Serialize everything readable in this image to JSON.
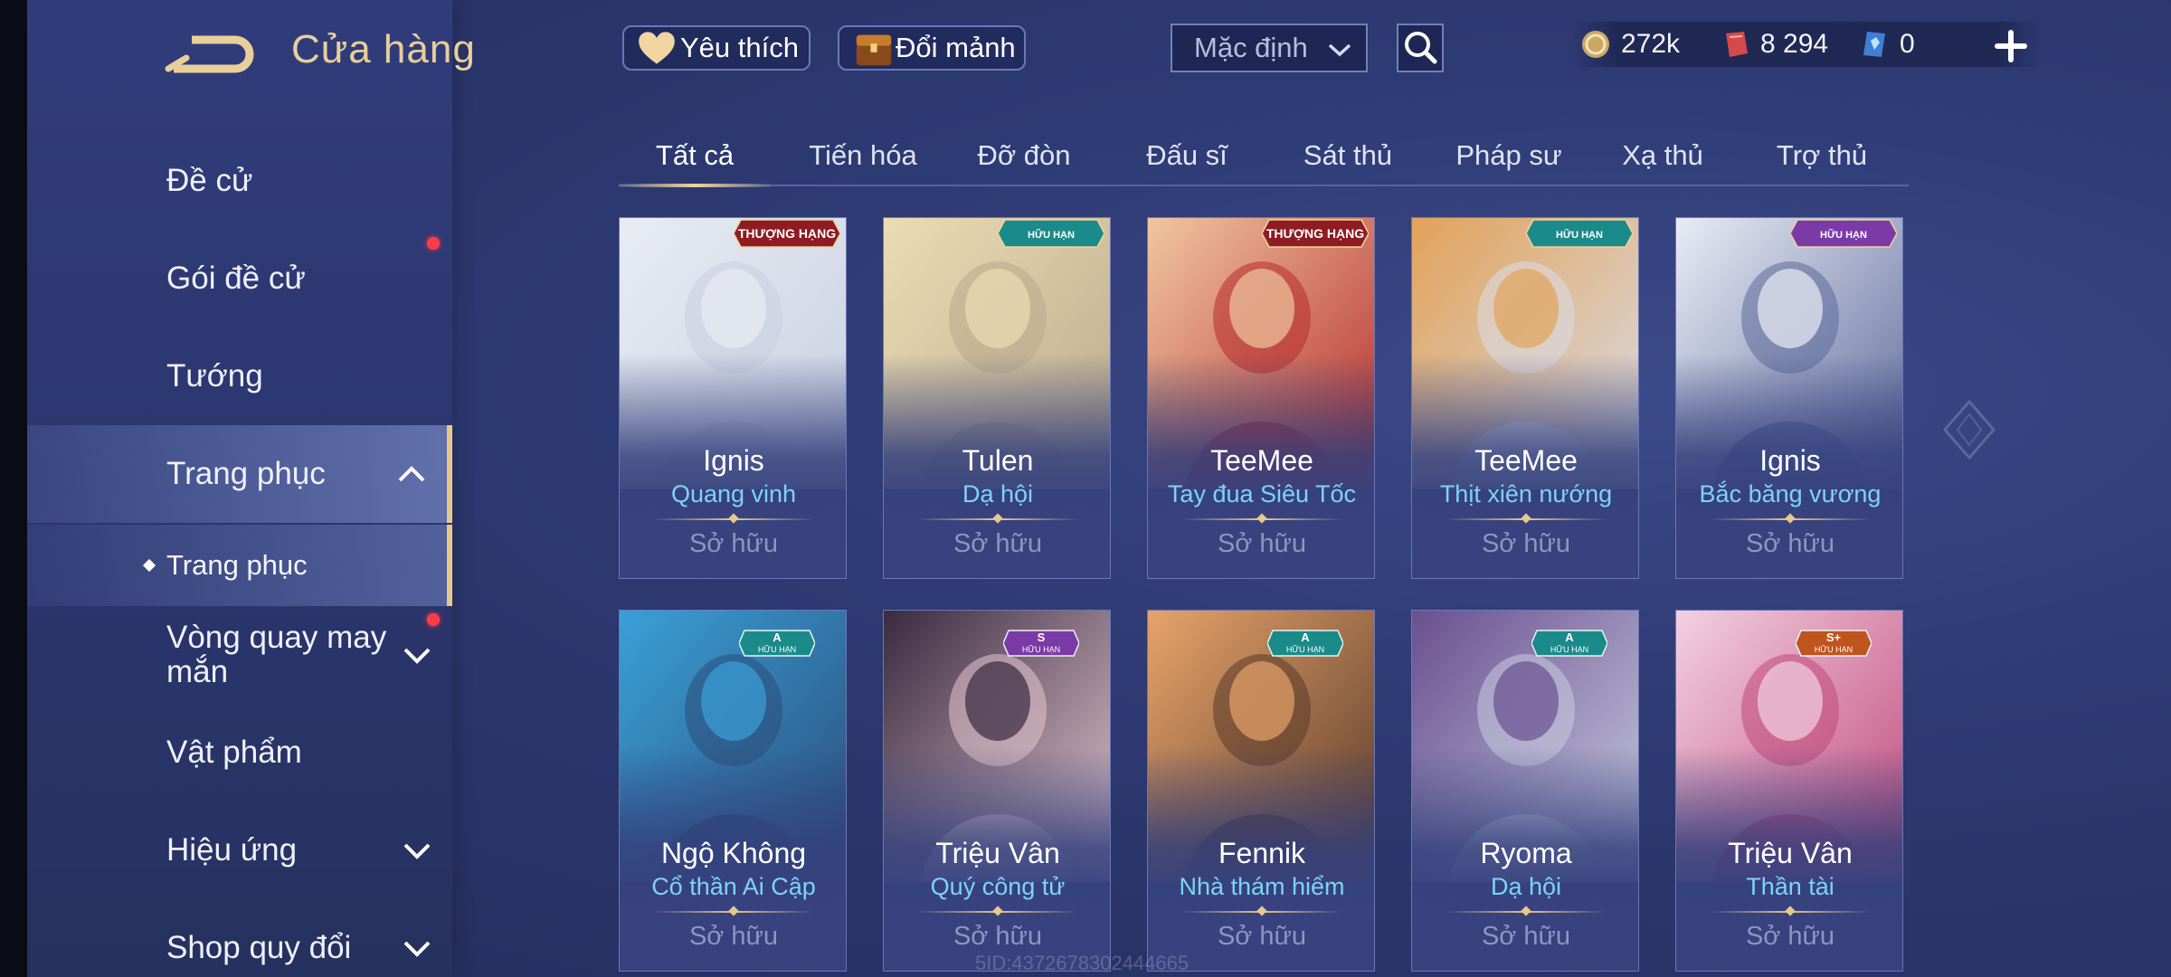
{
  "header": {
    "title": "Cửa hàng",
    "favorite_label": "Yêu thích",
    "exchange_label": "Đổi mảnh",
    "sort_value": "Mặc định"
  },
  "currency": {
    "gold": "272k",
    "voucher": "8 294",
    "diamond": "0"
  },
  "sidebar": {
    "items": [
      {
        "label": "Đề cử"
      },
      {
        "label": "Gói đề cử"
      },
      {
        "label": "Tướng"
      },
      {
        "label": "Trang phục"
      },
      {
        "label": "Trang phục"
      },
      {
        "label": "Vòng quay may mắn"
      },
      {
        "label": "Vật phẩm"
      },
      {
        "label": "Hiệu ứng"
      },
      {
        "label": "Shop quy đổi"
      }
    ]
  },
  "tabs": [
    "Tất cả",
    "Tiến hóa",
    "Đỡ đòn",
    "Đấu sĩ",
    "Sát thủ",
    "Pháp sư",
    "Xạ thủ",
    "Trợ thủ"
  ],
  "cards": [
    {
      "hero": "Ignis",
      "skin": "Quang vinh",
      "status": "Sở hữu",
      "badge": "THƯỢNG HẠNG",
      "badge_color": "#8e1c22",
      "art_bg": "#c9cfe0",
      "art_accent": "#e9ecf3"
    },
    {
      "hero": "Tulen",
      "skin": "Dạ hội",
      "status": "Sở hữu",
      "badge": "HỮU HẠN",
      "badge_color": "#1b8a8a",
      "art_bg": "#b9a98c",
      "art_accent": "#ecdcb4"
    },
    {
      "hero": "TeeMee",
      "skin": "Tay đua Siêu Tốc",
      "status": "Sở hữu",
      "badge": "THƯỢNG HẠNG",
      "badge_color": "#8e1c22",
      "art_bg": "#b62c2c",
      "art_accent": "#f0c6a0"
    },
    {
      "hero": "TeeMee",
      "skin": "Thịt xiên nướng",
      "status": "Sở hữu",
      "badge": "HỮU HẠN",
      "badge_color": "#1b8a8a",
      "art_bg": "#d9dde8",
      "art_accent": "#e2a25a"
    },
    {
      "hero": "Ignis",
      "skin": "Bắc băng vương",
      "status": "Sở hữu",
      "badge": "HỮU HẠN",
      "badge_color": "#7c3aa8",
      "art_bg": "#5d6a9a",
      "art_accent": "#e9ecf5"
    },
    {
      "hero": "Ngộ Không",
      "skin": "Cổ thần Ai Cập",
      "status": "Sở hữu",
      "badge": "HỮU HẠN",
      "rank": "A",
      "badge_color": "#1b8a8a",
      "art_bg": "#2b4d7a",
      "art_accent": "#3aa0d8"
    },
    {
      "hero": "Triệu Vân",
      "skin": "Quý công tử",
      "status": "Sở hữu",
      "badge": "HỮU HẠN",
      "rank": "S",
      "badge_color": "#7c3aa8",
      "art_bg": "#e4c7cf",
      "art_accent": "#3a2a40"
    },
    {
      "hero": "Fennik",
      "skin": "Nhà thám hiểm",
      "status": "Sở hữu",
      "badge": "HỮU HẠN",
      "rank": "A",
      "badge_color": "#1b8a8a",
      "art_bg": "#5a3a2a",
      "art_accent": "#e6a36a"
    },
    {
      "hero": "Ryoma",
      "skin": "Dạ hội",
      "status": "Sở hữu",
      "badge": "HỮU HẠN",
      "rank": "A",
      "badge_color": "#1b8a8a",
      "art_bg": "#c8cce0",
      "art_accent": "#6a5090"
    },
    {
      "hero": "Triệu Vân",
      "skin": "Thần tài",
      "status": "Sở hữu",
      "badge": "HỮU HẠN",
      "rank": "S+",
      "badge_color": "#c0541e",
      "art_bg": "#c0487a",
      "art_accent": "#f2d0e0"
    }
  ],
  "watermark": "5ID:4372678302444665",
  "colors": {
    "accent_gold": "#e6c88a",
    "skin_name": "#7fd3f2",
    "owned": "#8d96bf",
    "red_dot": "#ff3b4a"
  }
}
